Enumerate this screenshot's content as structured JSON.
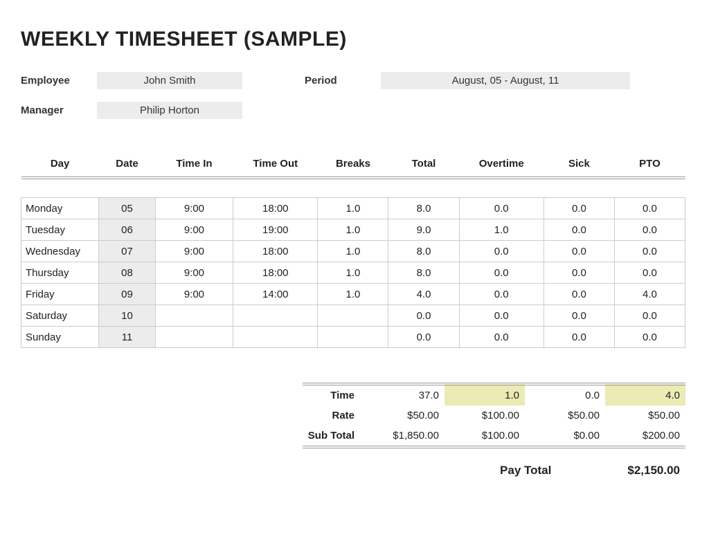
{
  "title": "WEEKLY TIMESHEET (SAMPLE)",
  "meta": {
    "employee_label": "Employee",
    "employee_value": "John Smith",
    "period_label": "Period",
    "period_value": "August, 05 - August, 11",
    "manager_label": "Manager",
    "manager_value": "Philip Horton"
  },
  "columns": {
    "day": "Day",
    "date": "Date",
    "time_in": "Time In",
    "time_out": "Time Out",
    "breaks": "Breaks",
    "total": "Total",
    "overtime": "Overtime",
    "sick": "Sick",
    "pto": "PTO"
  },
  "rows": [
    {
      "day": "Monday",
      "date": "05",
      "time_in": "9:00",
      "time_out": "18:00",
      "breaks": "1.0",
      "total": "8.0",
      "overtime": "0.0",
      "sick": "0.0",
      "pto": "0.0"
    },
    {
      "day": "Tuesday",
      "date": "06",
      "time_in": "9:00",
      "time_out": "19:00",
      "breaks": "1.0",
      "total": "9.0",
      "overtime": "1.0",
      "sick": "0.0",
      "pto": "0.0"
    },
    {
      "day": "Wednesday",
      "date": "07",
      "time_in": "9:00",
      "time_out": "18:00",
      "breaks": "1.0",
      "total": "8.0",
      "overtime": "0.0",
      "sick": "0.0",
      "pto": "0.0"
    },
    {
      "day": "Thursday",
      "date": "08",
      "time_in": "9:00",
      "time_out": "18:00",
      "breaks": "1.0",
      "total": "8.0",
      "overtime": "0.0",
      "sick": "0.0",
      "pto": "0.0"
    },
    {
      "day": "Friday",
      "date": "09",
      "time_in": "9:00",
      "time_out": "14:00",
      "breaks": "1.0",
      "total": "4.0",
      "overtime": "0.0",
      "sick": "0.0",
      "pto": "4.0"
    },
    {
      "day": "Saturday",
      "date": "10",
      "time_in": "",
      "time_out": "",
      "breaks": "",
      "total": "0.0",
      "overtime": "0.0",
      "sick": "0.0",
      "pto": "0.0"
    },
    {
      "day": "Sunday",
      "date": "11",
      "time_in": "",
      "time_out": "",
      "breaks": "",
      "total": "0.0",
      "overtime": "0.0",
      "sick": "0.0",
      "pto": "0.0"
    }
  ],
  "summary": {
    "time_label": "Time",
    "rate_label": "Rate",
    "subtotal_label": "Sub Total",
    "time": {
      "total": "37.0",
      "overtime": "1.0",
      "sick": "0.0",
      "pto": "4.0"
    },
    "rate": {
      "total": "$50.00",
      "overtime": "$100.00",
      "sick": "$50.00",
      "pto": "$50.00"
    },
    "subtotal": {
      "total": "$1,850.00",
      "overtime": "$100.00",
      "sick": "$0.00",
      "pto": "$200.00"
    }
  },
  "pay_total": {
    "label": "Pay Total",
    "value": "$2,150.00"
  },
  "chart_data": {
    "type": "table",
    "title": "WEEKLY TIMESHEET (SAMPLE)",
    "columns": [
      "Day",
      "Date",
      "Time In",
      "Time Out",
      "Breaks",
      "Total",
      "Overtime",
      "Sick",
      "PTO"
    ],
    "rows": [
      [
        "Monday",
        "05",
        "9:00",
        "18:00",
        1.0,
        8.0,
        0.0,
        0.0,
        0.0
      ],
      [
        "Tuesday",
        "06",
        "9:00",
        "19:00",
        1.0,
        9.0,
        1.0,
        0.0,
        0.0
      ],
      [
        "Wednesday",
        "07",
        "9:00",
        "18:00",
        1.0,
        8.0,
        0.0,
        0.0,
        0.0
      ],
      [
        "Thursday",
        "08",
        "9:00",
        "18:00",
        1.0,
        8.0,
        0.0,
        0.0,
        0.0
      ],
      [
        "Friday",
        "09",
        "9:00",
        "14:00",
        1.0,
        4.0,
        0.0,
        0.0,
        4.0
      ],
      [
        "Saturday",
        "10",
        null,
        null,
        null,
        0.0,
        0.0,
        0.0,
        0.0
      ],
      [
        "Sunday",
        "11",
        null,
        null,
        null,
        0.0,
        0.0,
        0.0,
        0.0
      ]
    ],
    "summary": {
      "time": {
        "total": 37.0,
        "overtime": 1.0,
        "sick": 0.0,
        "pto": 4.0
      },
      "rate": {
        "total": 50.0,
        "overtime": 100.0,
        "sick": 50.0,
        "pto": 50.0
      },
      "subtotal": {
        "total": 1850.0,
        "overtime": 100.0,
        "sick": 0.0,
        "pto": 200.0
      },
      "pay_total": 2150.0
    }
  }
}
